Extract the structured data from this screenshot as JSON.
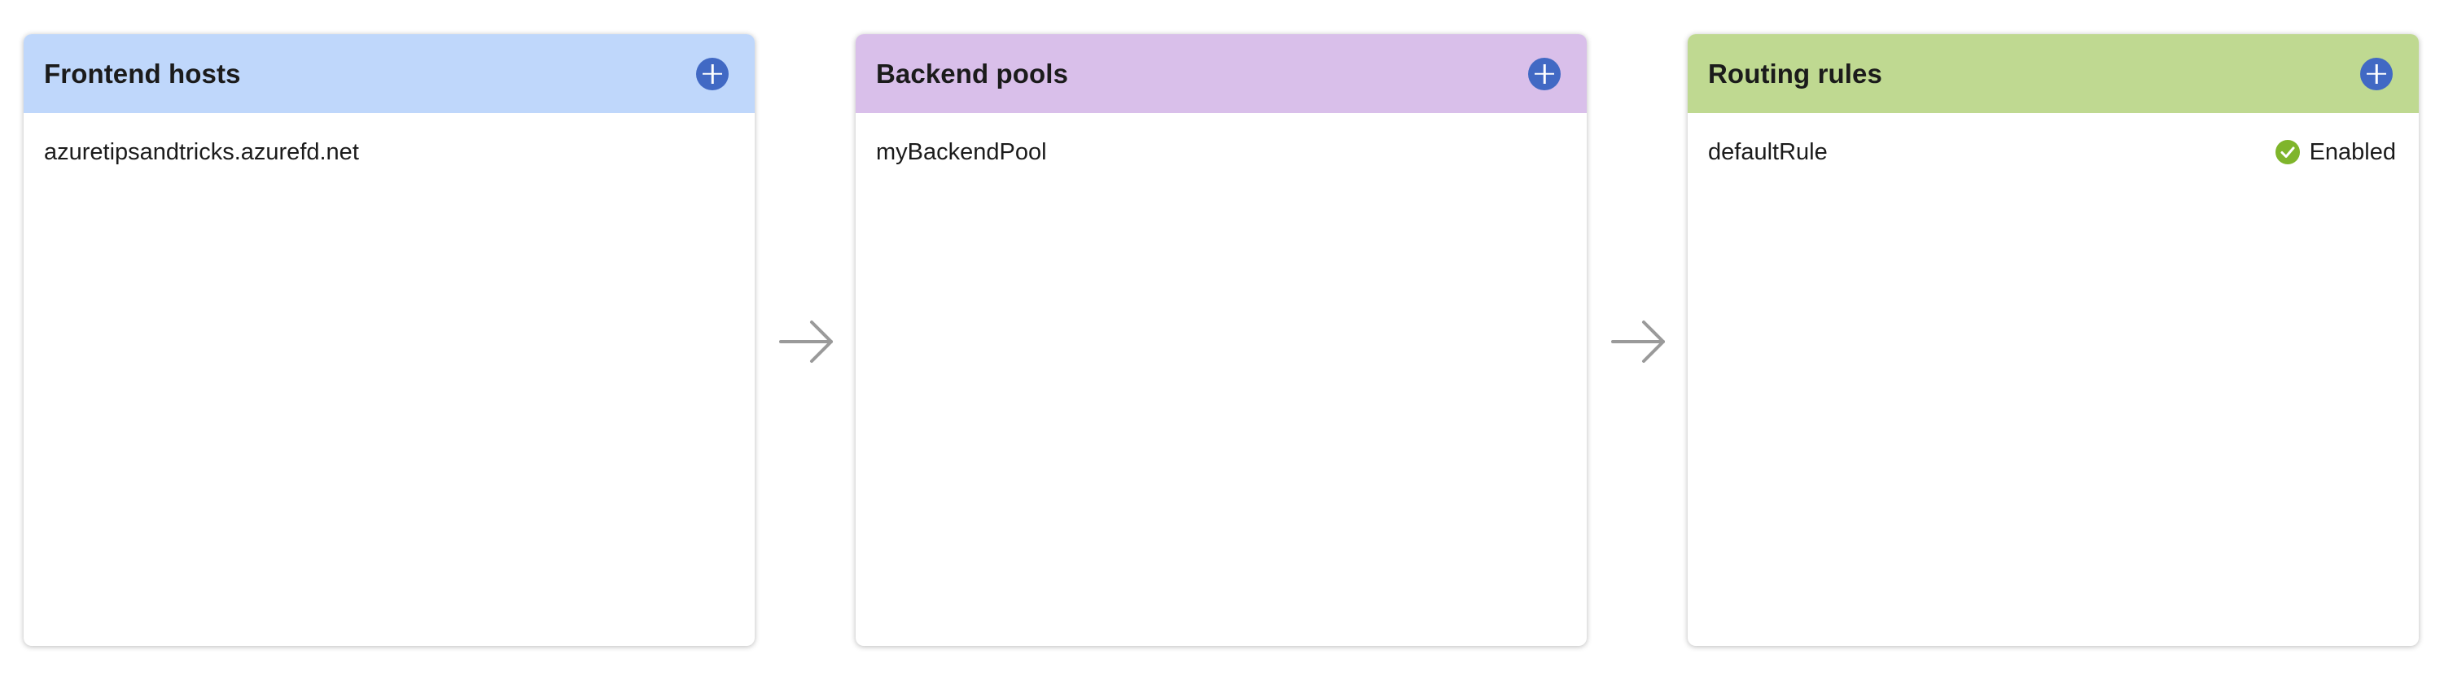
{
  "panels": [
    {
      "title": "Frontend hosts",
      "header_color": "#bfd7fb",
      "add_icon": "plus-circle-icon",
      "items": [
        {
          "label": "azuretipsandtricks.azurefd.net"
        }
      ]
    },
    {
      "title": "Backend pools",
      "header_color": "#d9bfea",
      "add_icon": "plus-circle-icon",
      "items": [
        {
          "label": "myBackendPool"
        }
      ]
    },
    {
      "title": "Routing rules",
      "header_color": "#bfd991",
      "add_icon": "plus-circle-icon",
      "items": [
        {
          "label": "defaultRule",
          "status": "Enabled",
          "status_icon": "check-circle-icon",
          "status_color": "#7fb52b"
        }
      ]
    }
  ],
  "connectors": [
    "arrow-right-icon",
    "arrow-right-icon"
  ],
  "colors": {
    "add_button": "#4169c4",
    "arrow": "#9a9a9a"
  }
}
